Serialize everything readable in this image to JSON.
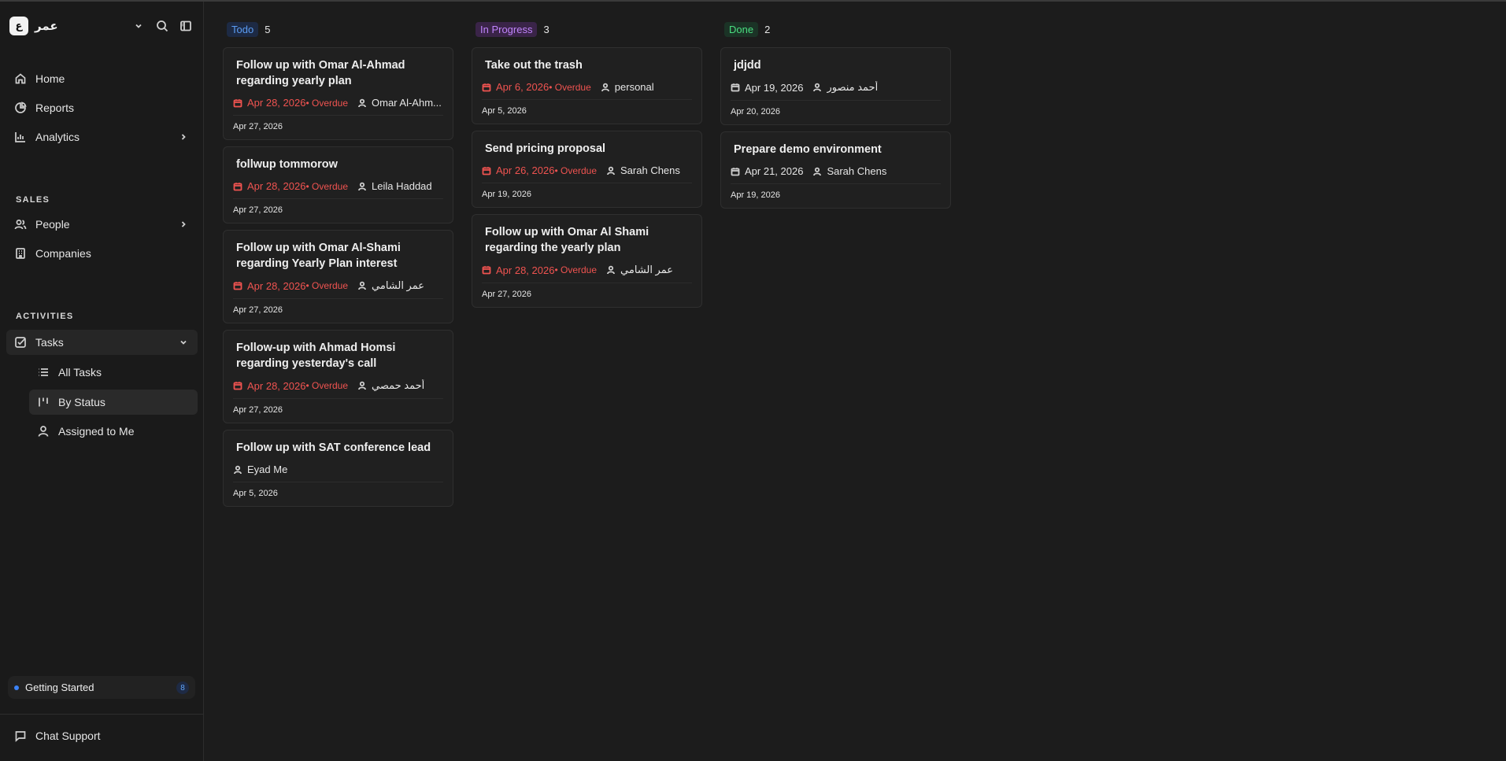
{
  "workspace": {
    "logo_text": "ع",
    "name": "عمر"
  },
  "nav": {
    "home": "Home",
    "reports": "Reports",
    "analytics": "Analytics",
    "sales_label": "SALES",
    "people": "People",
    "companies": "Companies",
    "activities_label": "ACTIVITIES",
    "tasks": "Tasks",
    "all_tasks": "All Tasks",
    "by_status": "By Status",
    "assigned_to_me": "Assigned to Me"
  },
  "footer": {
    "getting_started": "Getting Started",
    "getting_started_count": "8",
    "chat_support": "Chat Support"
  },
  "colors": {
    "todo_badge_bg": "#1d2a44",
    "todo_badge_fg": "#5b9cf2",
    "progress_badge_bg": "#3a2448",
    "progress_badge_fg": "#c084fc",
    "done_badge_bg": "#1b3326",
    "done_badge_fg": "#4ade80",
    "overdue": "#ef5350"
  },
  "columns": [
    {
      "label": "Todo",
      "count": "5",
      "cards": [
        {
          "title": "Follow up with Omar Al-Ahmad regarding yearly plan",
          "due": "Apr 28, 2026",
          "overdue_text": " • Overdue",
          "assignee": "Omar Al-Ahm...",
          "created": "Apr 27, 2026"
        },
        {
          "title": "follwup tommorow",
          "due": "Apr 28, 2026",
          "overdue_text": " • Overdue",
          "assignee": "Leila Haddad",
          "created": "Apr 27, 2026"
        },
        {
          "title": "Follow up with Omar Al-Shami regarding Yearly Plan interest",
          "due": "Apr 28, 2026",
          "overdue_text": " • Overdue",
          "assignee": "عمر الشامي",
          "created": "Apr 27, 2026"
        },
        {
          "title": "Follow-up with Ahmad Homsi regarding yesterday's call",
          "due": "Apr 28, 2026",
          "overdue_text": " • Overdue",
          "assignee": "أحمد حمصي",
          "created": "Apr 27, 2026"
        },
        {
          "title": "Follow up with SAT conference lead",
          "due": "",
          "overdue_text": "",
          "assignee": "Eyad Me",
          "created": "Apr 5, 2026"
        }
      ]
    },
    {
      "label": "In Progress",
      "count": "3",
      "cards": [
        {
          "title": "Take out the trash",
          "due": "Apr 6, 2026",
          "overdue_text": " • Overdue",
          "assignee": "personal",
          "created": "Apr 5, 2026"
        },
        {
          "title": "Send pricing proposal",
          "due": "Apr 26, 2026",
          "overdue_text": " • Overdue",
          "assignee": "Sarah Chens",
          "created": "Apr 19, 2026"
        },
        {
          "title": "Follow up with Omar Al Shami regarding the yearly plan",
          "due": "Apr 28, 2026",
          "overdue_text": " • Overdue",
          "assignee": "عمر الشامي",
          "created": "Apr 27, 2026"
        }
      ]
    },
    {
      "label": "Done",
      "count": "2",
      "cards": [
        {
          "title": "jdjdd",
          "due": "Apr 19, 2026",
          "overdue_text": "",
          "assignee": "أحمد منصور",
          "created": "Apr 20, 2026"
        },
        {
          "title": "Prepare demo environment",
          "due": "Apr 21, 2026",
          "overdue_text": "",
          "assignee": "Sarah Chens",
          "created": "Apr 19, 2026"
        }
      ]
    }
  ]
}
